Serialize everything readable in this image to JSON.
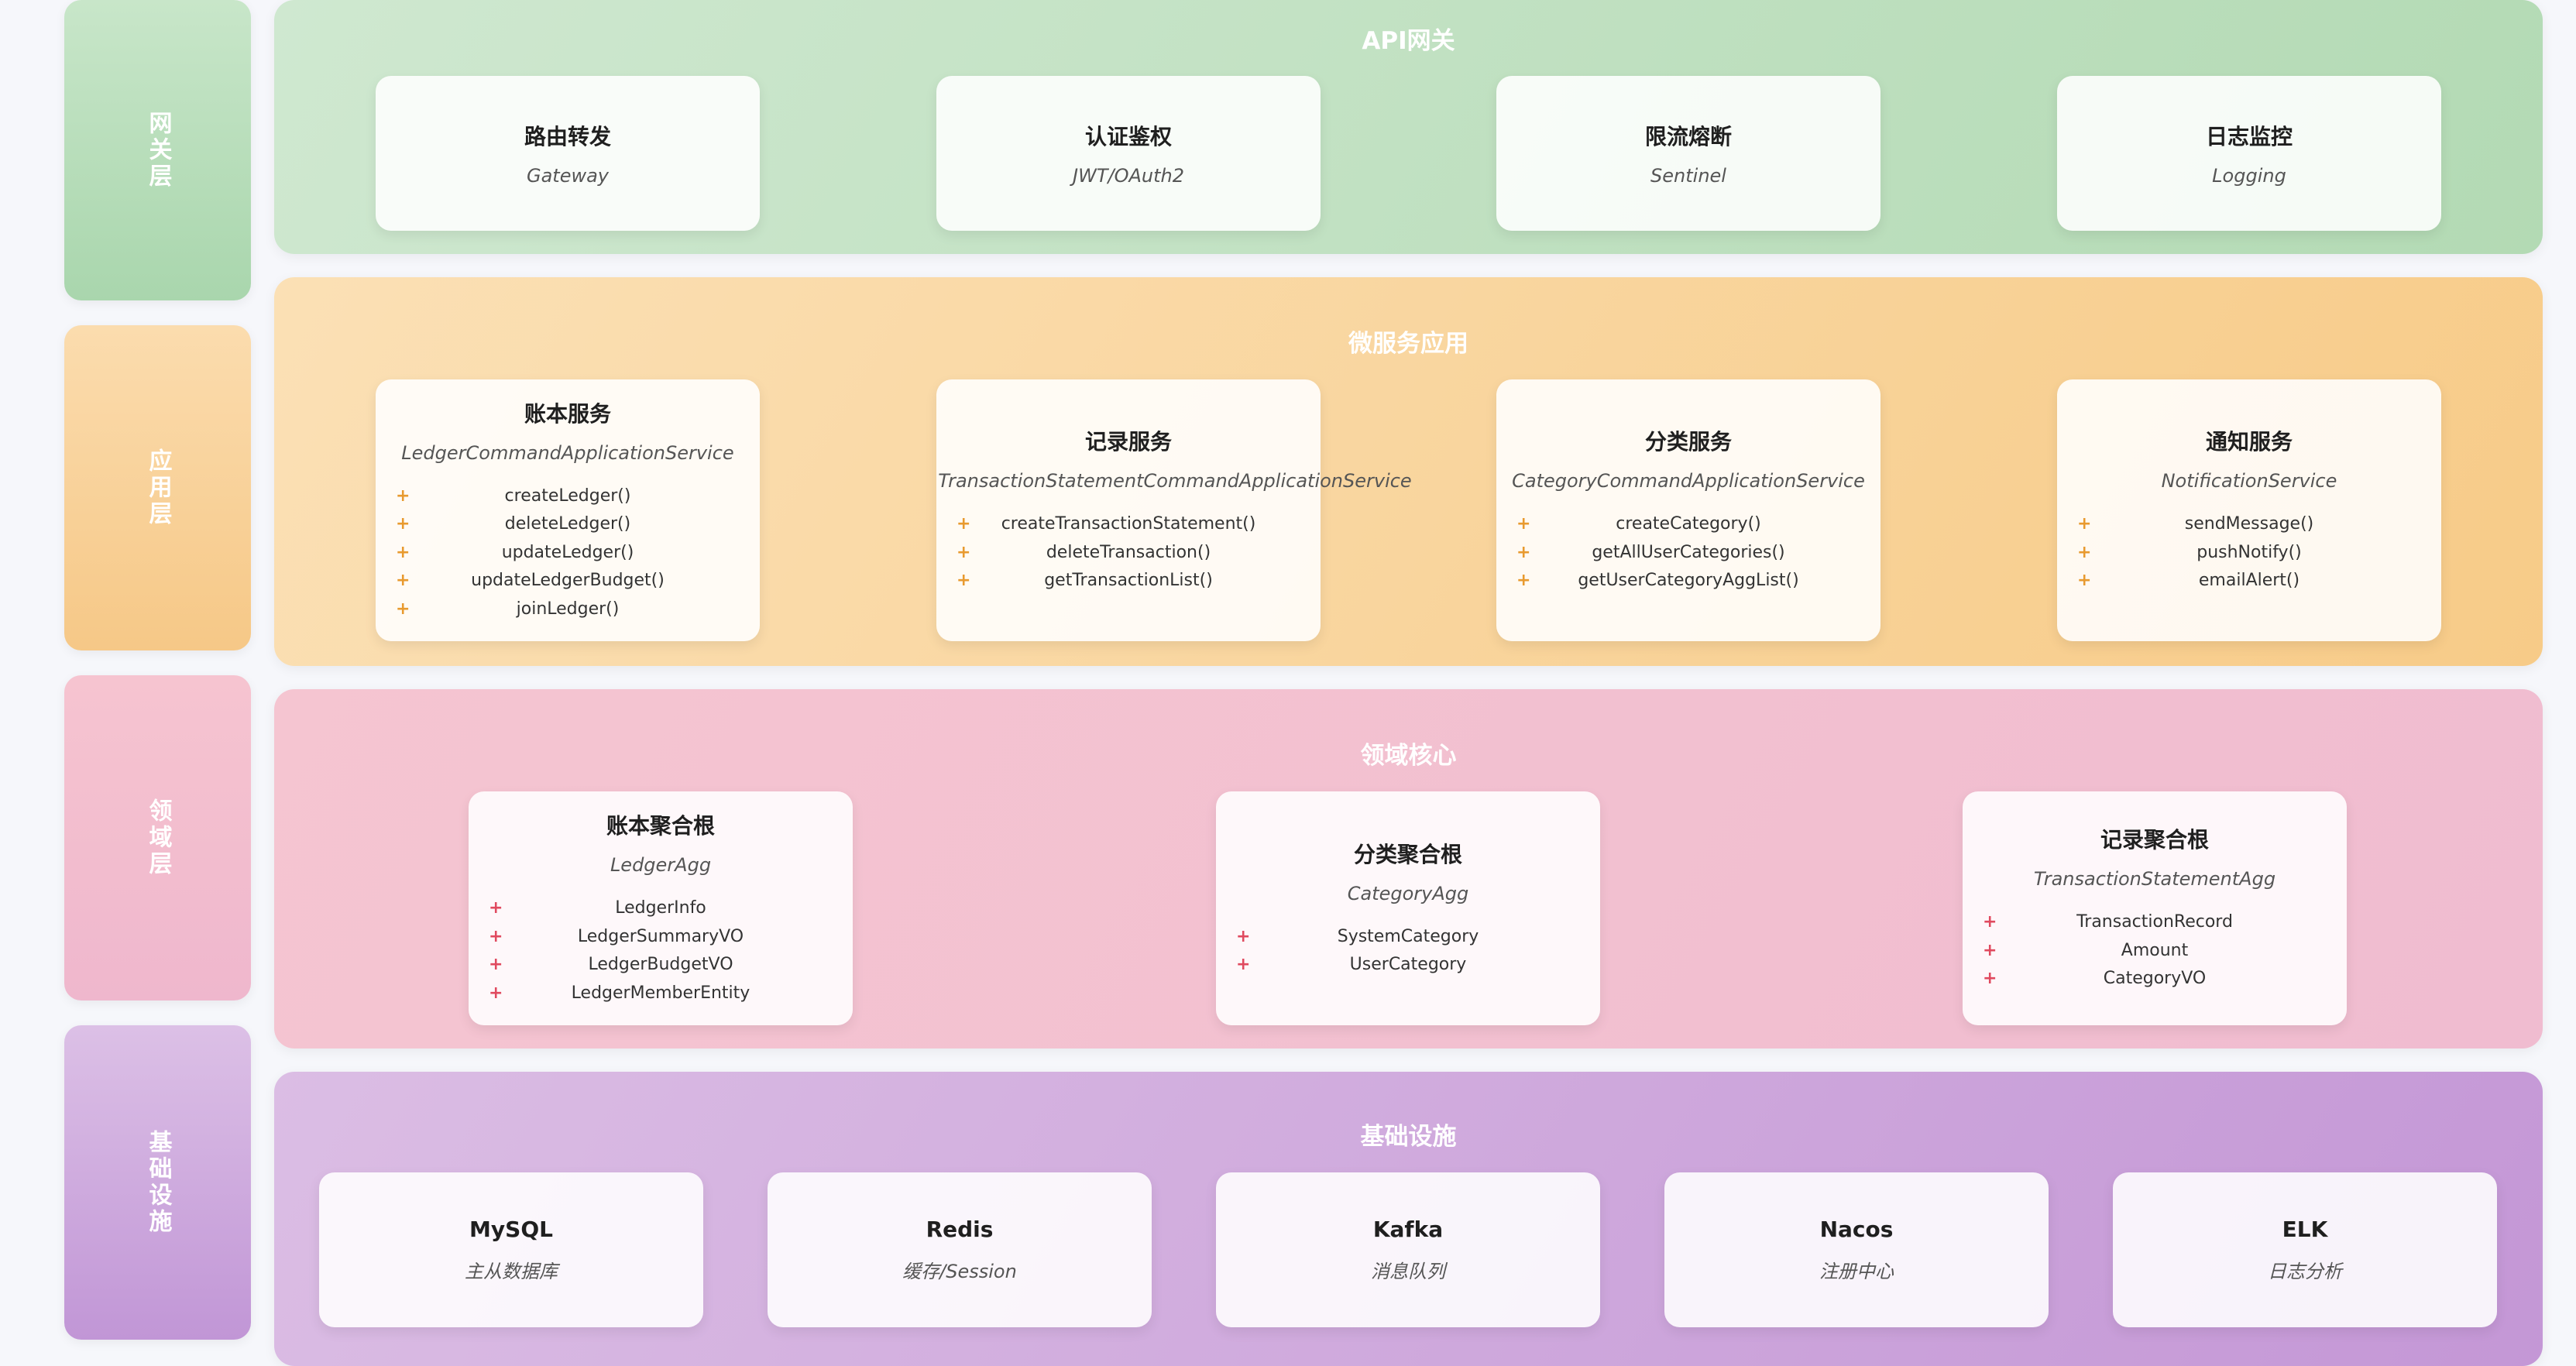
{
  "layers": [
    {
      "label": "网关层"
    },
    {
      "label": "应用层"
    },
    {
      "label": "领域层"
    },
    {
      "label": "基础设施"
    }
  ],
  "gateway": {
    "title": "API网关",
    "cards": [
      {
        "title": "路由转发",
        "sub": "Gateway"
      },
      {
        "title": "认证鉴权",
        "sub": "JWT/OAuth2"
      },
      {
        "title": "限流熔断",
        "sub": "Sentinel"
      },
      {
        "title": "日志监控",
        "sub": "Logging"
      }
    ]
  },
  "application": {
    "title": "微服务应用",
    "bullet": "+",
    "cards": [
      {
        "title": "账本服务",
        "sub": "LedgerCommandApplicationService",
        "items": [
          "createLedger()",
          "deleteLedger()",
          "updateLedger()",
          "updateLedgerBudget()",
          "joinLedger()"
        ]
      },
      {
        "title": "记录服务",
        "sub": "TransactionStatementCommandApplicationService",
        "items": [
          "createTransactionStatement()",
          "deleteTransaction()",
          "getTransactionList()"
        ]
      },
      {
        "title": "分类服务",
        "sub": "CategoryCommandApplicationService",
        "items": [
          "createCategory()",
          "getAllUserCategories()",
          "getUserCategoryAggList()"
        ]
      },
      {
        "title": "通知服务",
        "sub": "NotificationService",
        "items": [
          "sendMessage()",
          "pushNotify()",
          "emailAlert()"
        ]
      }
    ]
  },
  "domain": {
    "title": "领域核心",
    "bullet": "+",
    "cards": [
      {
        "title": "账本聚合根",
        "sub": "LedgerAgg",
        "items": [
          "LedgerInfo",
          "LedgerSummaryVO",
          "LedgerBudgetVO",
          "LedgerMemberEntity"
        ]
      },
      {
        "title": "分类聚合根",
        "sub": "CategoryAgg",
        "items": [
          "SystemCategory",
          "UserCategory"
        ]
      },
      {
        "title": "记录聚合根",
        "sub": "TransactionStatementAgg",
        "items": [
          "TransactionRecord",
          "Amount",
          "CategoryVO"
        ]
      }
    ]
  },
  "infrastructure": {
    "title": "基础设施",
    "cards": [
      {
        "title": "MySQL",
        "sub": "主从数据库"
      },
      {
        "title": "Redis",
        "sub": "缓存/Session"
      },
      {
        "title": "Kafka",
        "sub": "消息队列"
      },
      {
        "title": "Nacos",
        "sub": "注册中心"
      },
      {
        "title": "ELK",
        "sub": "日志分析"
      }
    ]
  },
  "colors": {
    "gateway": "#c6e5c8",
    "application": "#f9d89e",
    "domain": "#f3c0cf",
    "infrastructure": "#d1a9dd",
    "app_bullet": "#e89a2f",
    "domain_bullet": "#e04a5f"
  }
}
